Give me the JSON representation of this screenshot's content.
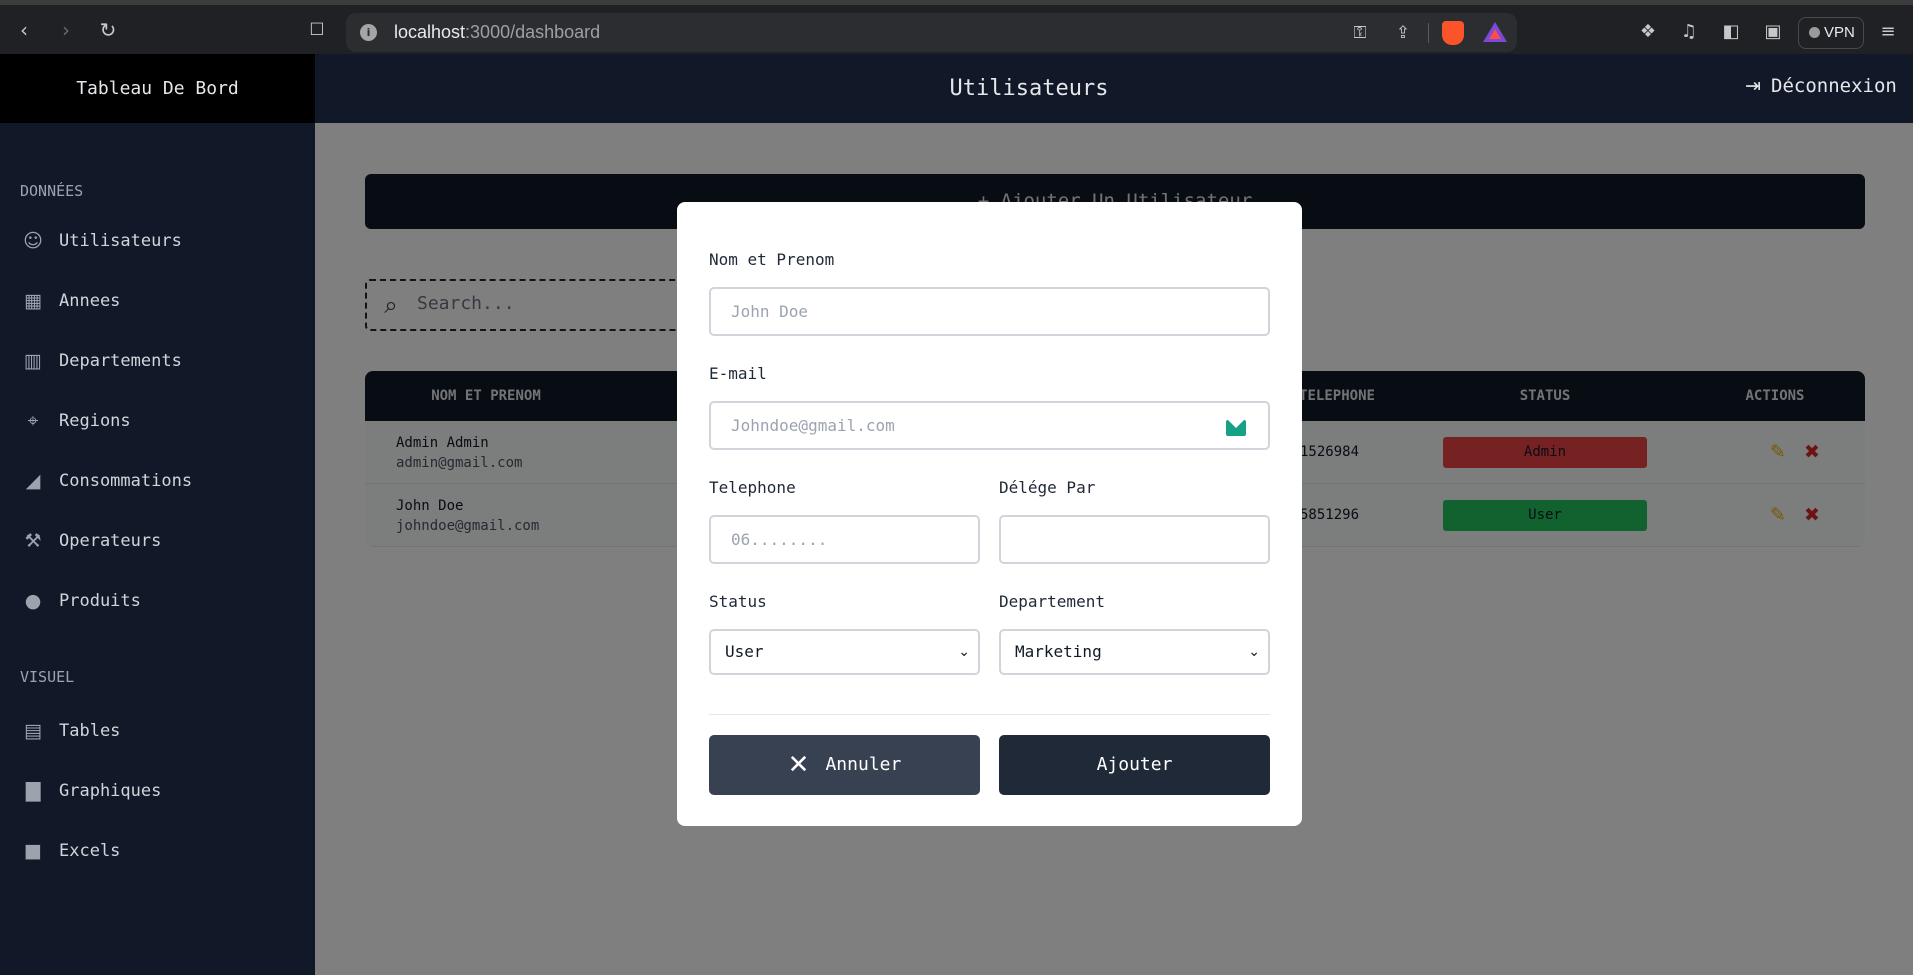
{
  "browser": {
    "url_host": "localhost",
    "url_path": ":3000/dashboard",
    "vpn_label": "VPN"
  },
  "sidebar": {
    "title": "Tableau De Bord",
    "section_data": "DONNÉES",
    "section_visual": "VISUEL",
    "items": [
      {
        "label": "Utilisateurs",
        "icon": "users-icon"
      },
      {
        "label": "Annees",
        "icon": "calendar-icon"
      },
      {
        "label": "Departements",
        "icon": "building-icon"
      },
      {
        "label": "Regions",
        "icon": "map-pin-icon"
      },
      {
        "label": "Consommations",
        "icon": "chart-area-icon"
      },
      {
        "label": "Operateurs",
        "icon": "operator-icon"
      },
      {
        "label": "Produits",
        "icon": "droplet-icon"
      }
    ],
    "visual_items": [
      {
        "label": "Tables",
        "icon": "table-icon"
      },
      {
        "label": "Graphiques",
        "icon": "bar-chart-icon"
      },
      {
        "label": "Excels",
        "icon": "document-icon"
      }
    ]
  },
  "header": {
    "title": "Utilisateurs",
    "logout_label": "Déconnexion"
  },
  "main": {
    "add_user_label": "+ Ajouter Un Utilisateur",
    "search_placeholder": "Search..."
  },
  "table": {
    "columns": [
      "NOM ET PRENOM",
      "TELEPHONE",
      "STATUS",
      "ACTIONS"
    ],
    "rows": [
      {
        "name": "Admin Admin",
        "email": "admin@gmail.com",
        "phone": "1526984",
        "status": "Admin"
      },
      {
        "name": "John Doe",
        "email": "johndoe@gmail.com",
        "phone": "5851296",
        "status": "User"
      }
    ]
  },
  "modal": {
    "name_label": "Nom et Prenom",
    "name_placeholder": "John Doe",
    "email_label": "E-mail",
    "email_placeholder": "Johndoe@gmail.com",
    "phone_label": "Telephone",
    "phone_placeholder": "06........",
    "delegate_label": "Délége Par",
    "delegate_value": "",
    "status_label": "Status",
    "status_value": "User",
    "department_label": "Departement",
    "department_value": "Marketing",
    "cancel_label": "Annuler",
    "submit_label": "Ajouter"
  },
  "colors": {
    "sidebar_bg": "#111827",
    "status_admin": "#ef4444",
    "status_user": "#22c55e"
  }
}
